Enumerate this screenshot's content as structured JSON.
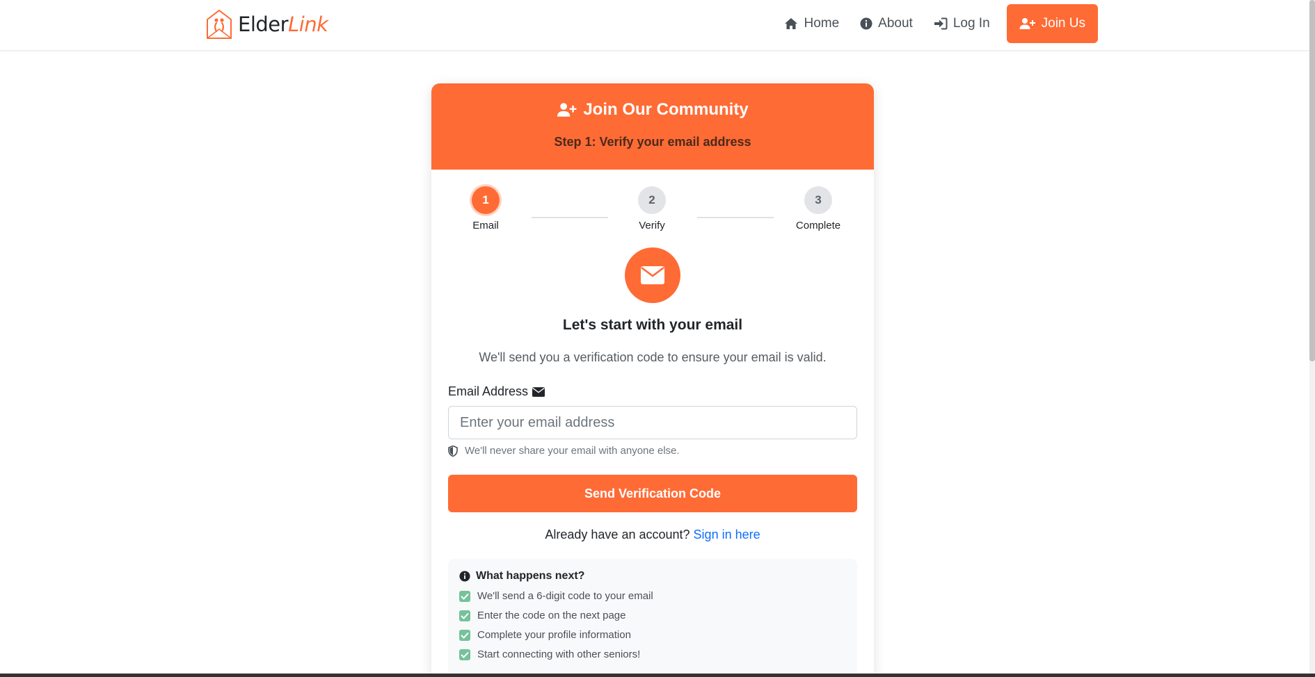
{
  "brand": {
    "name_main": "Elder",
    "name_accent": "Link"
  },
  "nav": {
    "home": "Home",
    "about": "About",
    "login": "Log In",
    "join": "Join Us"
  },
  "card": {
    "title": "Join Our Community",
    "subtitle": "Step 1: Verify your email address",
    "steps": [
      {
        "number": "1",
        "label": "Email",
        "state": "active"
      },
      {
        "number": "2",
        "label": "Verify",
        "state": "inactive"
      },
      {
        "number": "3",
        "label": "Complete",
        "state": "inactive"
      }
    ],
    "heading": "Let's start with your email",
    "lead": "We'll send you a verification code to ensure your email is valid.",
    "email_label": "Email Address",
    "email_placeholder": "Enter your email address",
    "email_value": "",
    "help_text": "We'll never share your email with anyone else.",
    "submit_label": "Send Verification Code",
    "signin_prompt": "Already have an account?",
    "signin_link": "Sign in here",
    "info_title": "What happens next?",
    "info_items": [
      "We'll send a 6-digit code to your email",
      "Enter the code on the next page",
      "Complete your profile information",
      "Start connecting with other seniors!"
    ]
  },
  "colors": {
    "accent": "#ff6b35",
    "link": "#0d6efd",
    "check": "#75c29a"
  }
}
